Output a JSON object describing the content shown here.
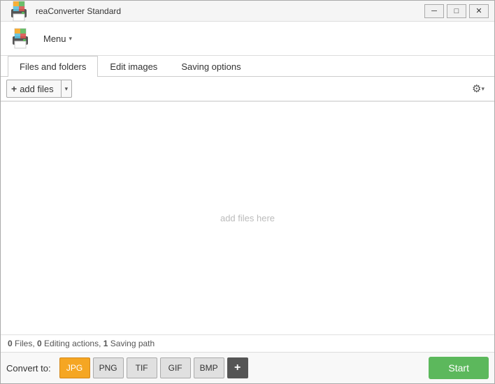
{
  "window": {
    "title": "reaConverter Standard",
    "controls": {
      "minimize": "─",
      "maximize": "□",
      "close": "✕"
    }
  },
  "menu": {
    "label": "Menu",
    "chevron": "▾"
  },
  "tabs": [
    {
      "id": "files",
      "label": "Files and folders",
      "active": true
    },
    {
      "id": "edit",
      "label": "Edit images",
      "active": false
    },
    {
      "id": "saving",
      "label": "Saving options",
      "active": false
    }
  ],
  "toolbar": {
    "add_files_label": "+ add files",
    "dropdown_arrow": "▾"
  },
  "file_area": {
    "placeholder": "add files here"
  },
  "status": {
    "text_prefix": " ",
    "files_count": "0",
    "files_label": " Files, ",
    "editing_count": "0",
    "editing_label": " Editing actions, ",
    "saving_count": "1",
    "saving_label": " Saving path"
  },
  "bottom_bar": {
    "convert_label": "Convert to:",
    "formats": [
      {
        "id": "jpg",
        "label": "JPG",
        "selected": true
      },
      {
        "id": "png",
        "label": "PNG",
        "selected": false
      },
      {
        "id": "tif",
        "label": "TIF",
        "selected": false
      },
      {
        "id": "gif",
        "label": "GIF",
        "selected": false
      },
      {
        "id": "bmp",
        "label": "BMP",
        "selected": false
      }
    ],
    "add_format": "+",
    "start_label": "Start"
  }
}
